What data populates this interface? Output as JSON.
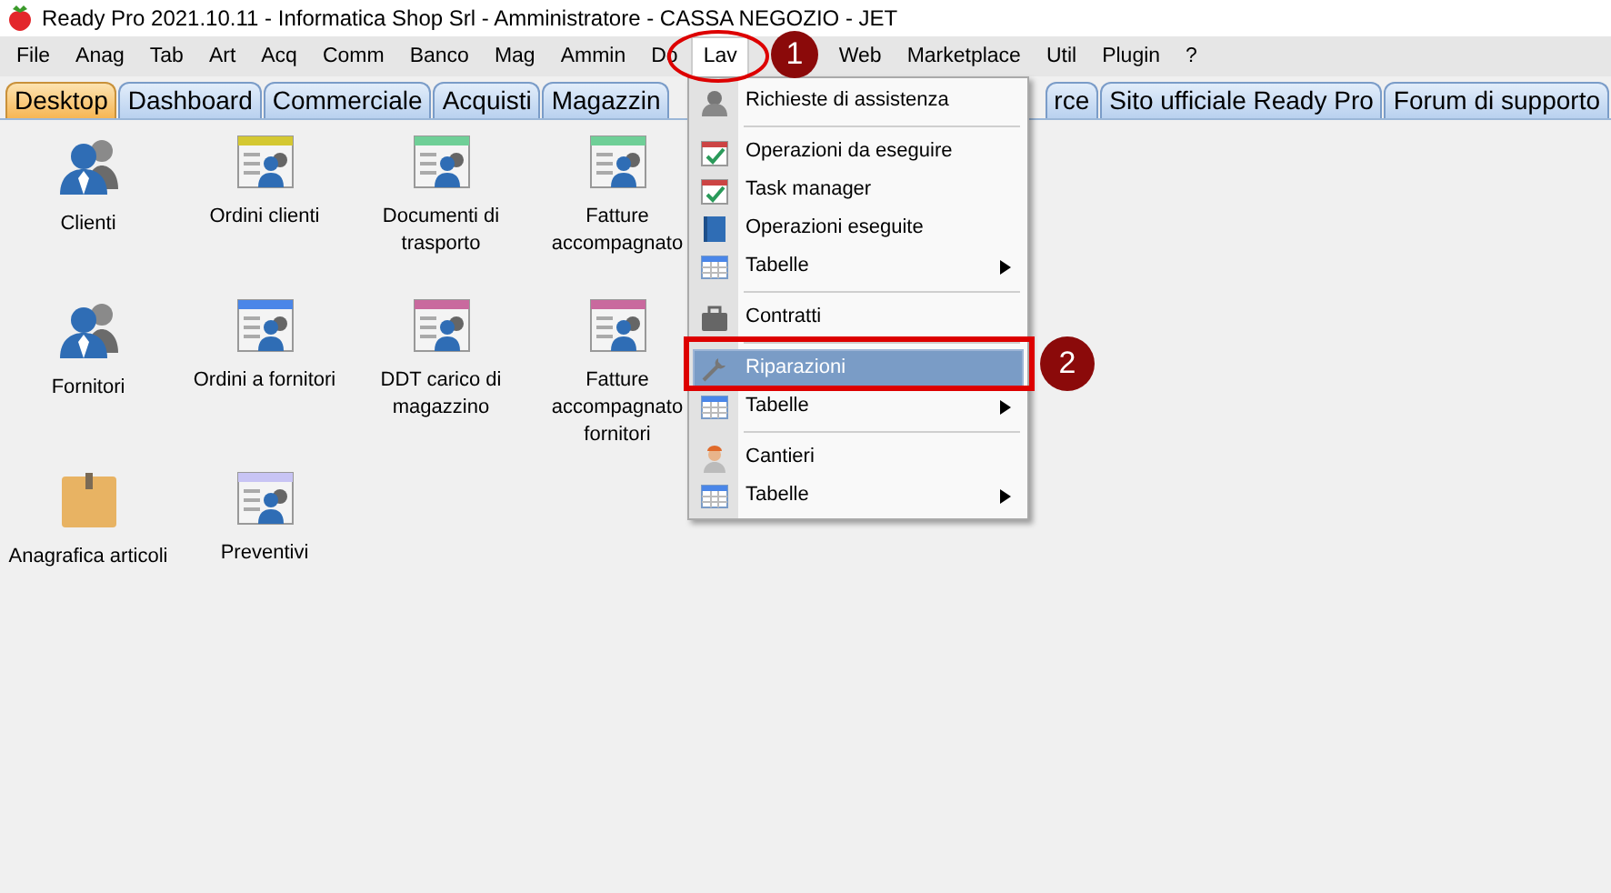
{
  "window": {
    "title": "Ready Pro 2021.10.11 - Informatica Shop Srl - Amministratore - CASSA NEGOZIO - JET"
  },
  "menu_bar": [
    {
      "label": "File",
      "selected": false
    },
    {
      "label": "Anag",
      "selected": false
    },
    {
      "label": "Tab",
      "selected": false
    },
    {
      "label": "Art",
      "selected": false
    },
    {
      "label": "Acq",
      "selected": false
    },
    {
      "label": "Comm",
      "selected": false
    },
    {
      "label": "Banco",
      "selected": false
    },
    {
      "label": "Mag",
      "selected": false
    },
    {
      "label": "Ammin",
      "selected": false
    },
    {
      "label": "Do",
      "selected": false
    },
    {
      "label": "Lav",
      "selected": true
    },
    {
      "label": "Web",
      "selected": false
    },
    {
      "label": "Marketplace",
      "selected": false
    },
    {
      "label": "Util",
      "selected": false
    },
    {
      "label": "Plugin",
      "selected": false
    },
    {
      "label": "?",
      "selected": false
    }
  ],
  "tabs": [
    {
      "label": "Desktop",
      "selected": true
    },
    {
      "label": "Dashboard",
      "selected": false
    },
    {
      "label": "Commerciale",
      "selected": false
    },
    {
      "label": "Acquisti",
      "selected": false
    },
    {
      "label": "Magazzin",
      "selected": false
    },
    {
      "label": "rce",
      "selected": false
    },
    {
      "label": "Sito ufficiale Ready Pro",
      "selected": false
    },
    {
      "label": "Forum di supporto",
      "selected": false
    }
  ],
  "desktop_icons": [
    {
      "label": "Clienti",
      "kind": "person"
    },
    {
      "label": "Ordini clienti",
      "kind": "document",
      "color": "#d4c832"
    },
    {
      "label": "Documenti di trasporto",
      "kind": "document",
      "color": "#6fcf97"
    },
    {
      "label": "Fatture accompagnato",
      "kind": "document",
      "color": "#6fcf97"
    },
    {
      "label": "Fornitori",
      "kind": "person"
    },
    {
      "label": "Ordini a fornitori",
      "kind": "document",
      "color": "#4a86e8"
    },
    {
      "label": "DDT carico di magazzino",
      "kind": "document",
      "color": "#c9699e"
    },
    {
      "label": "Fatture accompagnato fornitori",
      "kind": "document",
      "color": "#c9699e"
    },
    {
      "label": "Anagrafica articoli",
      "kind": "box"
    },
    {
      "label": "Preventivi",
      "kind": "document",
      "color": "#c8c4f4"
    }
  ],
  "dropdown": [
    {
      "kind": "item",
      "label": "Richieste di assistenza",
      "selected": false,
      "submenu": false
    },
    {
      "kind": "separator"
    },
    {
      "kind": "item",
      "label": "Operazioni da eseguire",
      "selected": false,
      "submenu": false
    },
    {
      "kind": "item",
      "label": "Task manager",
      "selected": false,
      "submenu": false
    },
    {
      "kind": "item",
      "label": "Operazioni eseguite",
      "selected": false,
      "submenu": false
    },
    {
      "kind": "item",
      "label": "Tabelle",
      "selected": false,
      "submenu": true
    },
    {
      "kind": "separator"
    },
    {
      "kind": "item",
      "label": "Contratti",
      "selected": false,
      "submenu": false
    },
    {
      "kind": "separator"
    },
    {
      "kind": "item",
      "label": "Riparazioni",
      "selected": true,
      "submenu": false
    },
    {
      "kind": "item",
      "label": "Tabelle",
      "selected": false,
      "submenu": true
    },
    {
      "kind": "separator"
    },
    {
      "kind": "item",
      "label": "Cantieri",
      "selected": false,
      "submenu": false
    },
    {
      "kind": "item",
      "label": "Tabelle",
      "selected": false,
      "submenu": true
    }
  ],
  "annotations": [
    {
      "kind": "ellipse",
      "number": "1"
    },
    {
      "kind": "rectangle",
      "number": "2"
    }
  ]
}
